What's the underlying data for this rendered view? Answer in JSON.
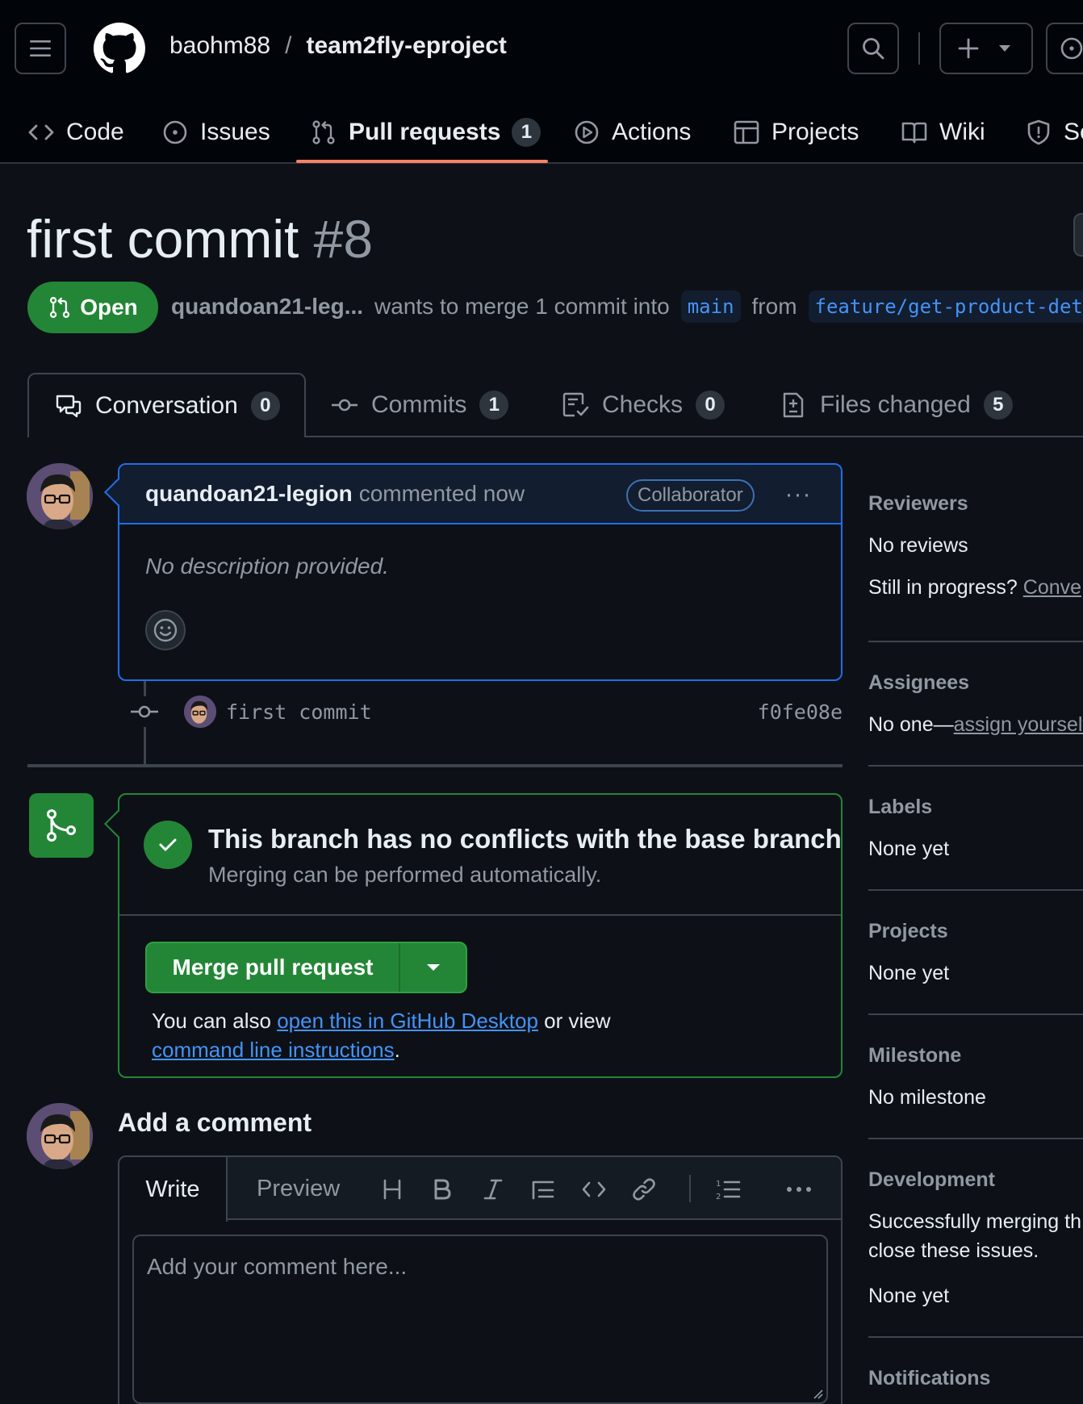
{
  "header": {
    "owner": "baohm88",
    "separator": "/",
    "repo": "team2fly-eproject"
  },
  "repo_tabs": [
    {
      "label": "Code",
      "icon": "code-icon"
    },
    {
      "label": "Issues",
      "icon": "issue-icon"
    },
    {
      "label": "Pull requests",
      "icon": "pull-request-icon",
      "count": "1",
      "active": true
    },
    {
      "label": "Actions",
      "icon": "play-icon"
    },
    {
      "label": "Projects",
      "icon": "table-icon"
    },
    {
      "label": "Wiki",
      "icon": "book-icon"
    },
    {
      "label": "Se",
      "icon": "shield-icon"
    }
  ],
  "pr": {
    "title": "first commit",
    "number": "#8",
    "state": "Open",
    "author_short": "quandoan21-leg...",
    "merge_text": "wants to merge 1 commit into",
    "base": "main",
    "from_text": "from",
    "head": "feature/get-product-det"
  },
  "pr_tabs": [
    {
      "label": "Conversation",
      "count": "0",
      "icon": "comment-discussion-icon"
    },
    {
      "label": "Commits",
      "count": "1",
      "icon": "git-commit-icon"
    },
    {
      "label": "Checks",
      "count": "0",
      "icon": "checklist-icon"
    },
    {
      "label": "Files changed",
      "count": "5",
      "icon": "file-diff-icon"
    }
  ],
  "comment": {
    "author": "quandoan21-legion",
    "time_text": "commented now",
    "badge": "Collaborator",
    "body": "No description provided.",
    "more": "···"
  },
  "commit": {
    "message": "first commit",
    "sha": "f0fe08e"
  },
  "merge": {
    "title": "This branch has no conflicts with the base branch",
    "subtitle": "Merging can be performed automatically.",
    "button": "Merge pull request",
    "also_prefix": "You can also",
    "desktop_link": "open this in GitHub Desktop",
    "or_view": "or view",
    "cli_link": "command line instructions",
    "period": "."
  },
  "add_comment": {
    "heading": "Add a comment",
    "write_tab": "Write",
    "preview_tab": "Preview",
    "placeholder": "Add your comment here..."
  },
  "sidebar": {
    "reviewers": {
      "heading": "Reviewers",
      "value": "No reviews",
      "in_progress": "Still in progress?",
      "convert_link": "Conve"
    },
    "assignees": {
      "heading": "Assignees",
      "prefix": "No one—",
      "link": "assign yourself"
    },
    "labels": {
      "heading": "Labels",
      "value": "None yet"
    },
    "projects": {
      "heading": "Projects",
      "value": "None yet"
    },
    "milestone": {
      "heading": "Milestone",
      "value": "No milestone"
    },
    "development": {
      "heading": "Development",
      "line1": "Successfully merging th",
      "line2": "close these issues.",
      "value": "None yet"
    },
    "notifications": {
      "heading": "Notifications"
    }
  },
  "colors": {
    "bg": "#0d1117",
    "header_bg": "#010409",
    "green": "#238636",
    "accent_blue": "#4493f8",
    "underline": "#f78166"
  }
}
